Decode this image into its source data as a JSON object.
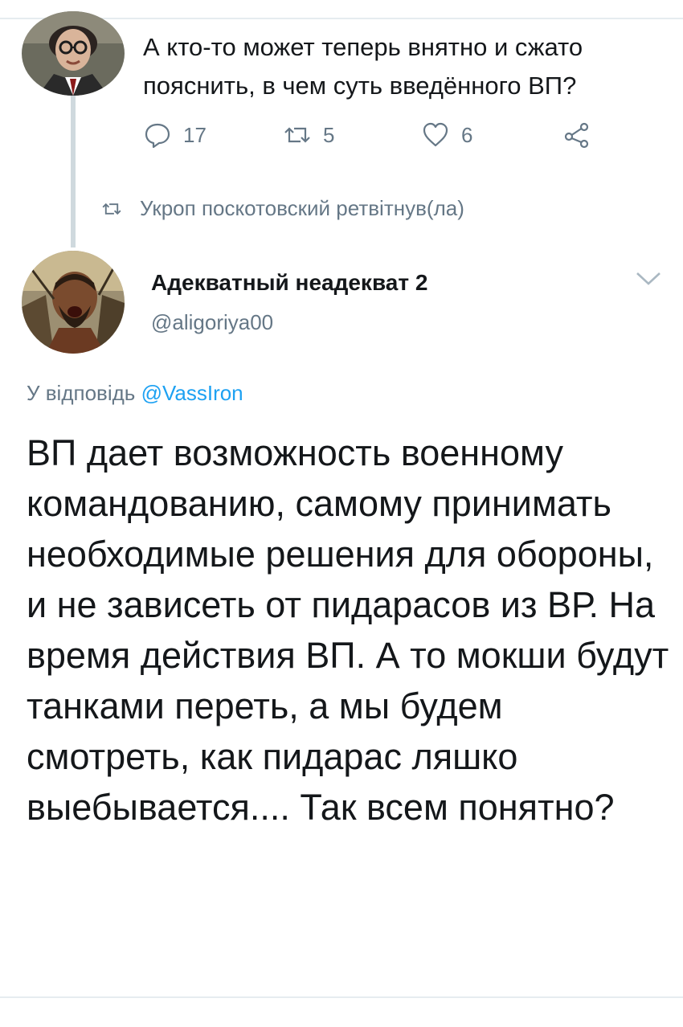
{
  "previous_tweet": {
    "text": "А кто-то может теперь внятно и сжато пояснить, в чем суть введённого ВП?",
    "actions": {
      "reply_count": "17",
      "retweet_count": "5",
      "like_count": "6"
    }
  },
  "retweet_notice": {
    "text": "Укроп поскотовский ретвітнув(ла)"
  },
  "tweet": {
    "author_name": "Адекватный неадекват 2",
    "author_handle": "@aligoriya00",
    "reply_prefix": "У відповідь ",
    "reply_mention": "@VassIron",
    "body": "ВП дает возможность военному командованию, самому принимать необходимые решения для обороны, и не зависеть от пидарасов из ВР. На время действия ВП. А то мокши будут танками переть, а мы будем смотреть, как пидарас ляшко выебывается.... Так всем понятно?"
  },
  "colors": {
    "text": "#14171a",
    "secondary": "#657786",
    "link": "#1da1f2",
    "divider": "#e6ecf0",
    "thread_line": "#cfd9de"
  },
  "icons": [
    "reply-icon",
    "retweet-icon",
    "like-icon",
    "share-icon",
    "retweet-small-icon",
    "chevron-down-icon"
  ]
}
